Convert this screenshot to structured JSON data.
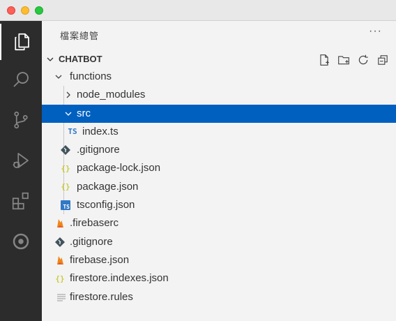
{
  "sidebar": {
    "title": "檔案總管",
    "more": "···"
  },
  "explorer": {
    "section_title": "CHATBOT",
    "actions": [
      "new-file-icon",
      "new-folder-icon",
      "refresh-icon",
      "collapse-all-icon"
    ],
    "items": [
      {
        "label": "functions",
        "type": "folder",
        "expanded": true,
        "depth": 1
      },
      {
        "label": "node_modules",
        "type": "folder",
        "expanded": false,
        "depth": 2
      },
      {
        "label": "src",
        "type": "folder",
        "expanded": true,
        "depth": 2,
        "selected": true
      },
      {
        "label": "index.ts",
        "type": "ts",
        "depth": 3,
        "icon_text": "TS"
      },
      {
        "label": ".gitignore",
        "type": "git",
        "depth": 2
      },
      {
        "label": "package-lock.json",
        "type": "json",
        "depth": 2,
        "icon_text": "{}"
      },
      {
        "label": "package.json",
        "type": "json",
        "depth": 2,
        "icon_text": "{}"
      },
      {
        "label": "tsconfig.json",
        "type": "tsconfig",
        "depth": 2,
        "icon_text": "TS"
      },
      {
        "label": ".firebaserc",
        "type": "firebase",
        "depth": 1
      },
      {
        "label": ".gitignore",
        "type": "git",
        "depth": 1
      },
      {
        "label": "firebase.json",
        "type": "firebase",
        "depth": 1
      },
      {
        "label": "firestore.indexes.json",
        "type": "json",
        "depth": 1,
        "icon_text": "{}"
      },
      {
        "label": "firestore.rules",
        "type": "text",
        "depth": 1
      }
    ]
  },
  "activity_bar": [
    "explorer-icon",
    "search-icon",
    "source-control-icon",
    "run-debug-icon",
    "extensions-icon",
    "remote-icon"
  ],
  "colors": {
    "selection": "#0060c0",
    "activity_bar": "#2c2c2c",
    "sidebar_bg": "#f3f3f3",
    "json_icon": "#cbcb41",
    "ts_icon": "#3178c6",
    "firebase_icon": "#f0851b",
    "git_icon": "#41535b"
  }
}
